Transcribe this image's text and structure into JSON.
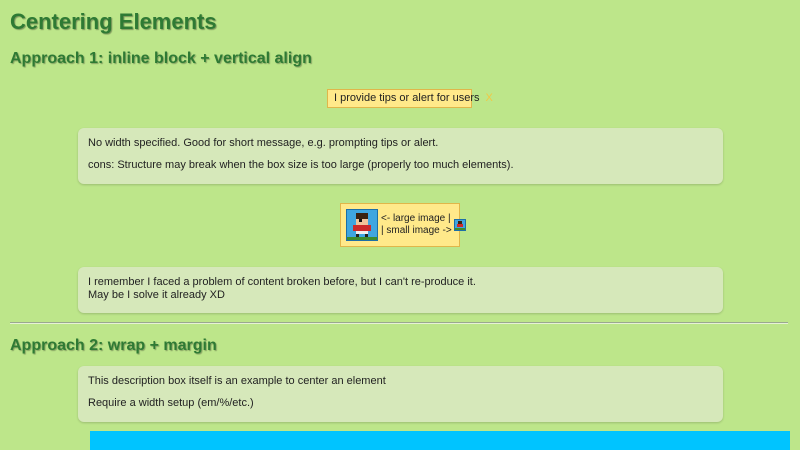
{
  "page_title": "Centering Elements",
  "approach1": {
    "heading": "Approach 1: inline block + vertical align",
    "tip": {
      "text": "I provide tips or alert for users",
      "close": "X"
    },
    "desc1": {
      "line1": "No width specified. Good for short message, e.g. prompting tips or alert.",
      "line2": "cons: Structure may break when the box size is too large (properly too much elements)."
    },
    "image_demo": {
      "caption_line1": "<- large image |",
      "caption_line2": "| small image ->",
      "large_image_icon": "pixel-character-icon",
      "small_image_icon": "pixel-character-icon"
    },
    "desc2": {
      "line1": "I remember I faced a problem of content broken before, but I can't re-produce it.",
      "line2": "May be I solve it already XD"
    }
  },
  "approach2": {
    "heading": "Approach 2: wrap + margin",
    "desc": {
      "line1": "This description box itself is an example to center an element",
      "line2": "Require a width setup (em/%/etc.)"
    },
    "demo_color": "#00c4ff"
  },
  "colors": {
    "background": "#bde68a",
    "heading": "#2e7a34",
    "tip_bg": "#ffe98a",
    "desc_bg": "#d6e8ba"
  }
}
